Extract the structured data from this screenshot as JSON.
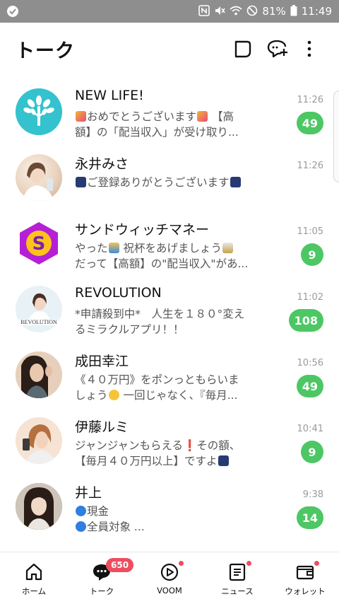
{
  "status_bar": {
    "battery": "81%",
    "time": "11:49"
  },
  "header": {
    "title": "トーク",
    "icons": [
      "square-icon",
      "new-chat-icon",
      "more-icon"
    ]
  },
  "chats": [
    {
      "name": "NEW LIFE!",
      "line1": "おめでとうございます",
      "line1_tail": "【高",
      "line2": "額】の「配当収入」が受け取り...",
      "time": "11:26",
      "unread": "49",
      "avatar_color": "#34c2cf"
    },
    {
      "name": "永井みさ",
      "line1": "ご登録ありがとうございます",
      "line2": "",
      "time": "11:26",
      "unread": "",
      "avatar_color": "#f1e4d7"
    },
    {
      "name": "サンドウィッチマネー",
      "line1": "やった",
      "line1_tail": "祝杯をあげましょう",
      "line2": "だって【高額】の\"配当収入\"があ...",
      "time": "11:05",
      "unread": "9",
      "avatar_color": "#b11fd1"
    },
    {
      "name": "REVOLUTION",
      "line1": "*申請殺到中*　人生を１８０°変え",
      "line2": "るミラクルアプリ！！",
      "time": "11:02",
      "unread": "108",
      "avatar_color": "#e6f1f5",
      "avatar_text": "REVOLUTION"
    },
    {
      "name": "成田幸江",
      "line1": "《４０万円》をポンっともらいま",
      "line2": "しょう",
      "line2_tail": "一回じゃなく、『毎月...",
      "time": "10:56",
      "unread": "49",
      "avatar_color": "#d7b59a"
    },
    {
      "name": "伊藤ルミ",
      "line1": "ジャンジャンもらえる❗その額、",
      "line2": "【毎月４０万円以上】ですよ",
      "time": "10:41",
      "unread": "9",
      "avatar_color": "#f0c9a8"
    },
    {
      "name": "井上",
      "line1": "現金",
      "line2": "全員対象 ...",
      "time": "9:38",
      "unread": "14",
      "avatar_color": "#8b6b5a"
    }
  ],
  "bottom_nav": [
    {
      "label": "ホーム",
      "icon": "home-icon"
    },
    {
      "label": "トーク",
      "icon": "talk-icon",
      "count": "650"
    },
    {
      "label": "VOOM",
      "icon": "voom-icon"
    },
    {
      "label": "ニュース",
      "icon": "news-icon"
    },
    {
      "label": "ウォレット",
      "icon": "wallet-icon"
    }
  ],
  "colors": {
    "badge": "#4cc764",
    "notification": "#ee4d5f",
    "status_bar": "#8e8e8e"
  }
}
